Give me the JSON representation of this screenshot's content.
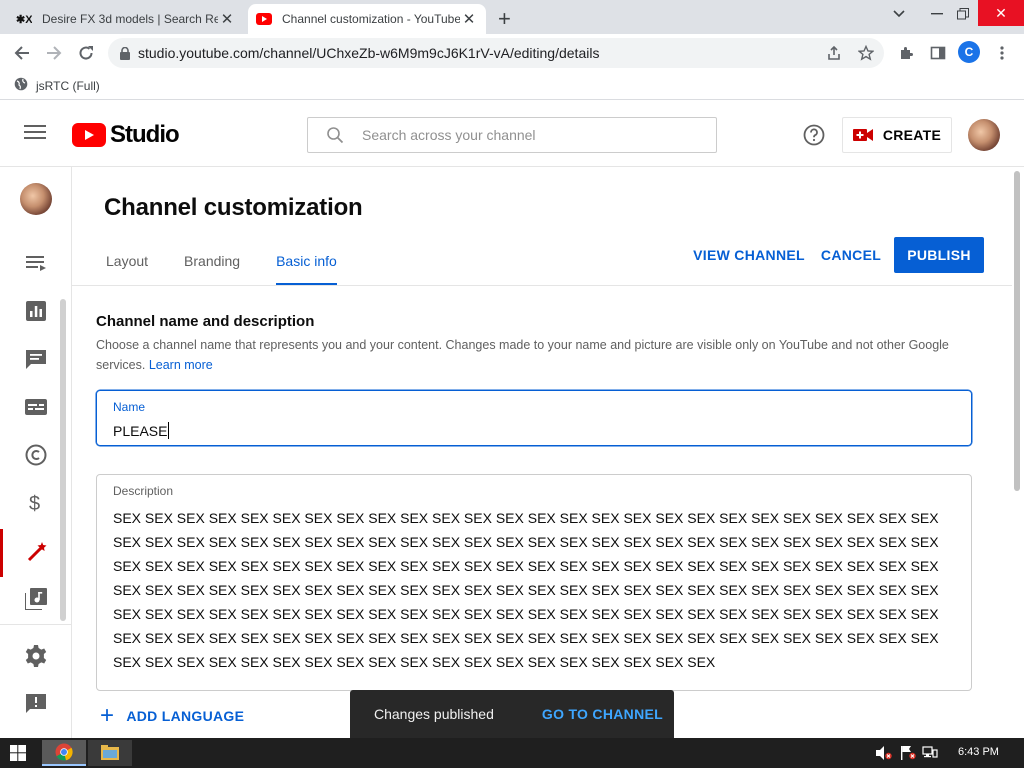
{
  "browser": {
    "tabs": [
      {
        "title": "Desire FX 3d models | Search Res",
        "favicon": "desirefx-logo-icon"
      },
      {
        "title": "Channel customization - YouTube",
        "favicon": "youtube-icon"
      }
    ],
    "url": "studio.youtube.com/channel/UChxeZb-w6M9m9cJ6K1rV-vA/editing/details",
    "profile_initial": "C",
    "bookmarks": [
      {
        "label": "jsRTC (Full)",
        "icon": "globe-icon"
      }
    ]
  },
  "header": {
    "logo_text": "Studio",
    "search_placeholder": "Search across your channel",
    "create_label": "CREATE"
  },
  "page": {
    "title": "Channel customization",
    "tabs": [
      {
        "label": "Layout",
        "selected": false
      },
      {
        "label": "Branding",
        "selected": false
      },
      {
        "label": "Basic info",
        "selected": true
      }
    ],
    "actions": {
      "view_channel": "VIEW CHANNEL",
      "cancel": "CANCEL",
      "publish": "PUBLISH"
    },
    "section": {
      "title": "Channel name and description",
      "description": "Choose a channel name that represents you and your content. Changes made to your name and picture are visible only on YouTube and not other Google services.",
      "learn_more": "Learn more"
    },
    "name_field": {
      "label": "Name",
      "value": "PLEASE"
    },
    "description_field": {
      "label": "Description",
      "value": "SEX SEX SEX SEX SEX SEX SEX SEX SEX SEX SEX SEX SEX SEX SEX SEX SEX SEX SEX SEX SEX SEX SEX SEX SEX SEX SEX SEX SEX SEX SEX SEX SEX SEX SEX SEX SEX SEX SEX SEX SEX SEX SEX SEX SEX SEX SEX SEX SEX SEX SEX SEX SEX SEX SEX SEX SEX SEX SEX SEX SEX SEX SEX SEX SEX SEX SEX SEX SEX SEX SEX SEX SEX SEX SEX SEX SEX SEX SEX SEX SEX SEX SEX SEX SEX SEX SEX SEX SEX SEX SEX SEX SEX SEX SEX SEX SEX SEX SEX SEX SEX SEX SEX SEX SEX SEX SEX SEX SEX SEX SEX SEX SEX SEX SEX SEX SEX SEX SEX SEX SEX SEX SEX SEX SEX SEX SEX SEX SEX SEX SEX SEX SEX SEX SEX SEX SEX SEX SEX SEX SEX SEX SEX SEX SEX SEX SEX SEX SEX SEX SEX SEX SEX SEX SEX SEX SEX SEX SEX SEX SEX SEX SEX SEX SEX SEX SEX SEX SEX SEX SEX SEX SEX SEX SEX"
    },
    "add_language": "ADD LANGUAGE"
  },
  "leftnav": {
    "items": [
      {
        "icon": "content-icon"
      },
      {
        "icon": "analytics-icon"
      },
      {
        "icon": "comments-icon"
      },
      {
        "icon": "subtitles-icon"
      },
      {
        "icon": "copyright-icon"
      },
      {
        "icon": "monetization-icon"
      },
      {
        "icon": "customization-icon",
        "active": true
      },
      {
        "icon": "audio-library-icon"
      },
      {
        "icon": "settings-icon"
      },
      {
        "icon": "send-feedback-icon"
      }
    ]
  },
  "snackbar": {
    "message": "Changes published",
    "action": "GO TO CHANNEL"
  },
  "taskbar": {
    "time": "6:43 PM"
  },
  "colors": {
    "accent": "#065fd4",
    "brand_red": "#ff0000",
    "active_nav": "#cc0000"
  }
}
